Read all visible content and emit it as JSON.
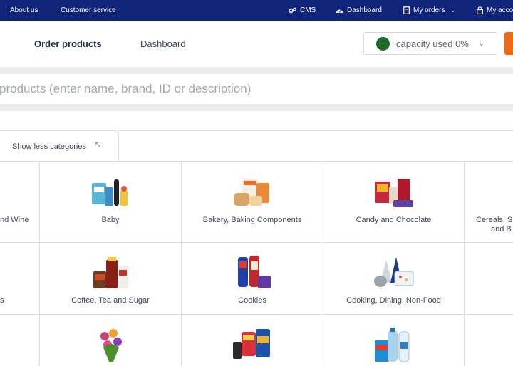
{
  "topbar": {
    "about": "About us",
    "service": "Customer service",
    "cms": "CMS",
    "dashboard": "Dashboard",
    "orders": "My orders",
    "account": "My acco"
  },
  "header": {
    "tab_order": "Order products",
    "tab_dashboard": "Dashboard",
    "capacity_label": "capacity used 0%"
  },
  "search": {
    "placeholder": "products (enter name, brand, ID or description)"
  },
  "categories": {
    "toggle_label": "Show less categories",
    "row1": [
      "nd Wine",
      "Baby",
      "Bakery, Baking Components",
      "Candy and Chocolate",
      "Cereals, S",
      "and B"
    ],
    "row2": [
      "s",
      "Coffee, Tea and Sugar",
      "Cookies",
      "Cooking, Dining, Non-Food"
    ]
  },
  "colors": {
    "topbar": "#10247a",
    "accent": "#f06a14",
    "capacity_dot": "#1d6b2a"
  }
}
